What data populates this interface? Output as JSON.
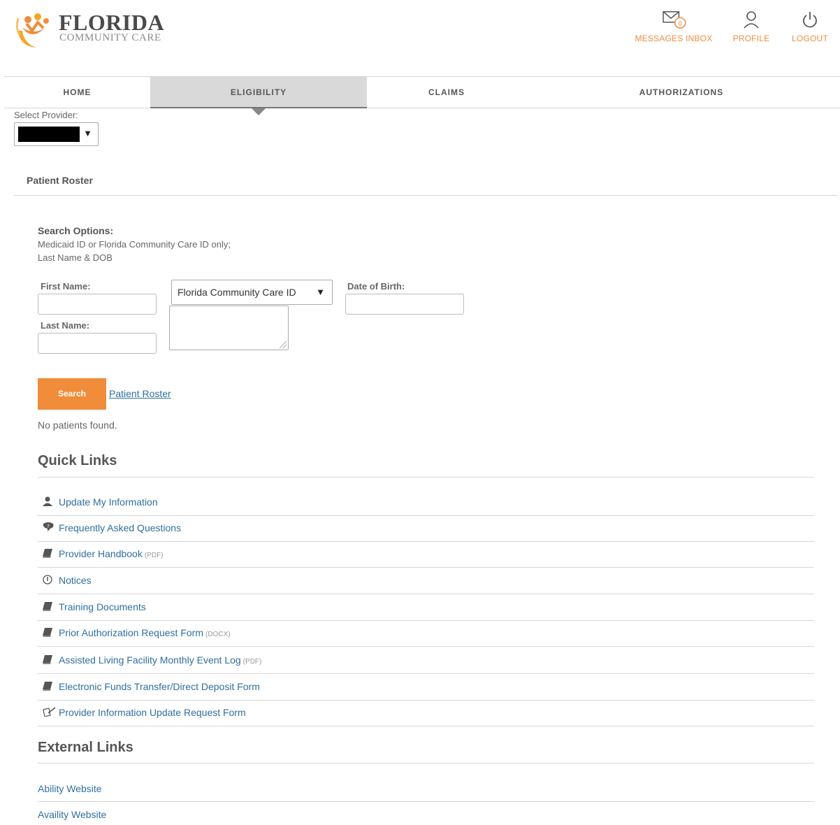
{
  "brand": {
    "name": "FLORIDA",
    "sub": "COMMUNITY CARE"
  },
  "header": {
    "messages_label": "MESSAGES INBOX",
    "messages_count": "0",
    "profile_label": "PROFILE",
    "logout_label": "LOGOUT"
  },
  "nav": {
    "tabs": [
      {
        "label": "HOME"
      },
      {
        "label": "ELIGIBILITY",
        "active": true
      },
      {
        "label": "CLAIMS"
      },
      {
        "label": "AUTHORIZATIONS"
      }
    ]
  },
  "provider": {
    "label": "Select Provider:"
  },
  "roster": {
    "title": "Patient Roster",
    "options_heading": "Search Options:",
    "options_line1": "Medicaid ID or Florida Community Care ID only;",
    "options_line2": "Last Name & DOB",
    "first_name_label": "First Name:",
    "last_name_label": "Last Name:",
    "dob_label": "Date of Birth:",
    "id_type_selected": "Florida Community Care ID",
    "search_button": "Search",
    "roster_link": "Patient Roster",
    "result_message": "No patients found."
  },
  "quick_links": {
    "heading": "Quick Links",
    "items": [
      {
        "label": "Update My Information",
        "suffix": "",
        "icon": "user-icon"
      },
      {
        "label": "Frequently Asked Questions",
        "suffix": "",
        "icon": "chat-bubble-icon"
      },
      {
        "label": "Provider Handbook",
        "suffix": "(PDF)",
        "icon": "book-icon"
      },
      {
        "label": "Notices",
        "suffix": "",
        "icon": "notice-icon"
      },
      {
        "label": "Training Documents",
        "suffix": "",
        "icon": "book-icon"
      },
      {
        "label": "Prior Authorization Request Form",
        "suffix": "(DOCX)",
        "icon": "book-icon"
      },
      {
        "label": "Assisted Living Facility Monthly Event Log",
        "suffix": "(PDF)",
        "icon": "book-icon"
      },
      {
        "label": "Electronic Funds Transfer/Direct Deposit Form",
        "suffix": "",
        "icon": "book-icon"
      },
      {
        "label": "Provider Information Update Request Form",
        "suffix": "",
        "icon": "pen-paper-icon"
      }
    ]
  },
  "external_links": {
    "heading": "External Links",
    "items": [
      {
        "label": "Ability Website"
      },
      {
        "label": "Availity Website"
      }
    ]
  },
  "colors": {
    "accent": "#f08c3a",
    "link": "#2f6f9f",
    "active_tab": "#d9d9d9"
  }
}
